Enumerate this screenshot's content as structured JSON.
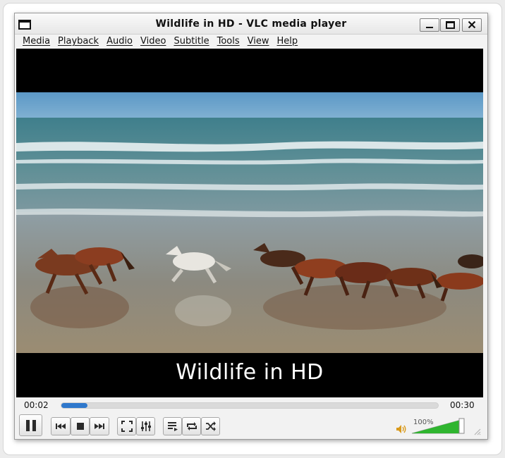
{
  "window": {
    "title": "Wildlife in HD - VLC media player"
  },
  "menu": [
    {
      "label": "Media"
    },
    {
      "label": "Playback"
    },
    {
      "label": "Audio"
    },
    {
      "label": "Video"
    },
    {
      "label": "Subtitle"
    },
    {
      "label": "Tools"
    },
    {
      "label": "View"
    },
    {
      "label": "Help"
    }
  ],
  "video": {
    "subtitle": "Wildlife in HD"
  },
  "playback": {
    "elapsed": "00:02",
    "total": "00:30",
    "progress": 0.07,
    "state": "playing"
  },
  "volume": {
    "label": "100%",
    "level": 1.0
  },
  "icons": {
    "play_pause": "pause-icon",
    "previous": "previous-icon",
    "stop": "stop-icon",
    "next": "next-icon",
    "fullscreen": "fullscreen-icon",
    "extended": "equalizer-icon",
    "playlist": "playlist-icon",
    "loop": "loop-icon",
    "random": "shuffle-icon",
    "volume": "speaker-icon"
  },
  "colors": {
    "seek_fill": "#2f78cc",
    "volume_fill": "#2fb52f"
  }
}
